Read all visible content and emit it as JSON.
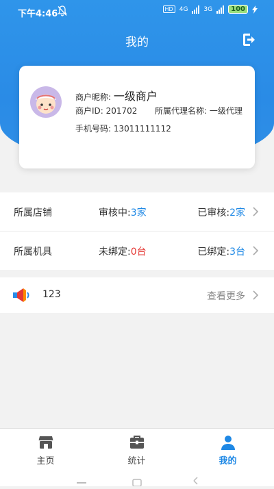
{
  "status_bar": {
    "time": "下午4:46",
    "hd": "HD",
    "net1": "4G",
    "net2": "3G",
    "battery": "100"
  },
  "header": {
    "title": "我的"
  },
  "profile": {
    "nickname_label": "商户昵称:",
    "nickname": "一级商户",
    "merchant_id": "商户ID: 201702",
    "agent_name": "所属代理名称: 一级代理",
    "phone": "手机号码: 13011111112"
  },
  "stats": {
    "stores": {
      "label": "所属店铺",
      "pending_label": "审核中:",
      "pending_value": "3家",
      "approved_label": "已审核:",
      "approved_value": "2家"
    },
    "machines": {
      "label": "所属机具",
      "unbound_label": "未绑定:",
      "unbound_value": "0台",
      "bound_label": "已绑定:",
      "bound_value": "3台"
    }
  },
  "notice": {
    "text": "123",
    "more": "查看更多"
  },
  "tabs": [
    {
      "label": "主页",
      "icon": "store-icon"
    },
    {
      "label": "统计",
      "icon": "briefcase-icon"
    },
    {
      "label": "我的",
      "icon": "user-icon",
      "active": true
    }
  ],
  "colors": {
    "accent": "#2a8be6",
    "blue_value": "#1e88e5",
    "red_value": "#e53935"
  }
}
